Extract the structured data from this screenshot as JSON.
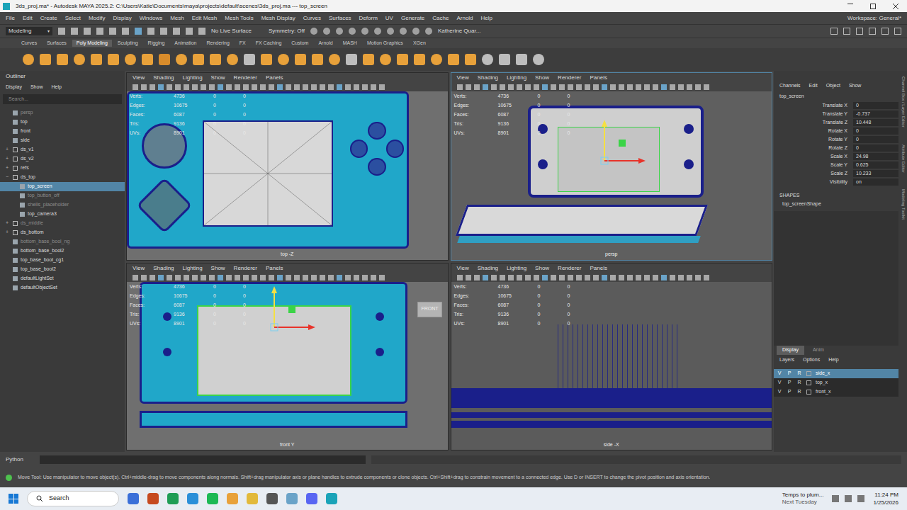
{
  "window": {
    "title": "3ds_proj.ma* - Autodesk MAYA 2025.2: C:\\Users\\Katie\\Documents\\maya\\projects\\default\\scenes\\3ds_proj.ma  ---  top_screen"
  },
  "menu_bar": [
    "File",
    "Edit",
    "Create",
    "Select",
    "Modify",
    "Display",
    "Windows",
    "Mesh",
    "Edit Mesh",
    "Mesh Tools",
    "Mesh Display",
    "Curves",
    "Surfaces",
    "Deform",
    "UV",
    "Generate",
    "Cache",
    "Arnold",
    "Help"
  ],
  "workspace": "Workspace: General*",
  "status_line": {
    "mode": "Modeling",
    "live_surface": "No Live Surface",
    "symmetry": "Symmetry: Off",
    "user": "Katherine Quar..."
  },
  "shelf": {
    "tabs": [
      {
        "label": "Curves",
        "selected": false
      },
      {
        "label": "Surfaces",
        "selected": false
      },
      {
        "label": "Poly Modeling",
        "selected": true
      },
      {
        "label": "Sculpting",
        "selected": false
      },
      {
        "label": "Rigging",
        "selected": false
      },
      {
        "label": "Animation",
        "selected": false
      },
      {
        "label": "Rendering",
        "selected": false
      },
      {
        "label": "FX",
        "selected": false
      },
      {
        "label": "FX Caching",
        "selected": false
      },
      {
        "label": "Custom",
        "selected": false
      },
      {
        "label": "Arnold",
        "selected": false
      },
      {
        "label": "MASH",
        "selected": false
      },
      {
        "label": "Motion Graphics",
        "selected": false
      },
      {
        "label": "XGen",
        "selected": false
      }
    ]
  },
  "outliner": {
    "title": "Outliner",
    "menu": [
      "Display",
      "Show",
      "Help"
    ],
    "search": "Search...",
    "items": [
      {
        "label": "persp",
        "depth": 0,
        "expandable": false,
        "expanded": false,
        "hidden": true,
        "selected": false
      },
      {
        "label": "top",
        "depth": 0,
        "expandable": false,
        "expanded": false,
        "hidden": false,
        "selected": false
      },
      {
        "label": "front",
        "depth": 0,
        "expandable": false,
        "expanded": false,
        "hidden": false,
        "selected": false
      },
      {
        "label": "side",
        "depth": 0,
        "expandable": false,
        "expanded": false,
        "hidden": false,
        "selected": false
      },
      {
        "label": "ds_v1",
        "depth": 0,
        "expandable": true,
        "expanded": false,
        "hidden": false,
        "selected": false
      },
      {
        "label": "ds_v2",
        "depth": 0,
        "expandable": true,
        "expanded": false,
        "hidden": false,
        "selected": false
      },
      {
        "label": "refs",
        "depth": 0,
        "expandable": true,
        "expanded": false,
        "hidden": false,
        "selected": false
      },
      {
        "label": "ds_top",
        "depth": 0,
        "expandable": true,
        "expanded": true,
        "hidden": false,
        "selected": false
      },
      {
        "label": "top_screen",
        "depth": 1,
        "expandable": false,
        "expanded": false,
        "hidden": false,
        "selected": true
      },
      {
        "label": "top_button_off",
        "depth": 1,
        "expandable": false,
        "expanded": false,
        "hidden": true,
        "selected": false
      },
      {
        "label": "shells_placeholder",
        "depth": 1,
        "expandable": false,
        "expanded": false,
        "hidden": true,
        "selected": false
      },
      {
        "label": "top_camera3",
        "depth": 1,
        "expandable": false,
        "expanded": false,
        "hidden": false,
        "selected": false
      },
      {
        "label": "ds_middle",
        "depth": 0,
        "expandable": true,
        "expanded": false,
        "hidden": true,
        "selected": false
      },
      {
        "label": "ds_bottom",
        "depth": 0,
        "expandable": true,
        "expanded": false,
        "hidden": false,
        "selected": false
      },
      {
        "label": "bottom_base_bool_ng",
        "depth": 0,
        "expandable": false,
        "expanded": false,
        "hidden": true,
        "selected": false
      },
      {
        "label": "bottom_base_bool2",
        "depth": 0,
        "expandable": false,
        "expanded": false,
        "hidden": false,
        "selected": false
      },
      {
        "label": "top_base_bool_cg1",
        "depth": 0,
        "expandable": false,
        "expanded": false,
        "hidden": false,
        "selected": false
      },
      {
        "label": "top_base_bool2",
        "depth": 0,
        "expandable": false,
        "expanded": false,
        "hidden": false,
        "selected": false
      },
      {
        "label": "defaultLightSet",
        "depth": 0,
        "expandable": false,
        "expanded": false,
        "hidden": false,
        "selected": false
      },
      {
        "label": "defaultObjectSet",
        "depth": 0,
        "expandable": false,
        "expanded": false,
        "hidden": false,
        "selected": false
      }
    ]
  },
  "viewport_menu": [
    "View",
    "Shading",
    "Lighting",
    "Show",
    "Renderer",
    "Panels"
  ],
  "hud": [
    {
      "label": "Verts:",
      "values": [
        "4736",
        "0",
        "0"
      ]
    },
    {
      "label": "Edges:",
      "values": [
        "10675",
        "0",
        "0"
      ]
    },
    {
      "label": "Faces:",
      "values": [
        "6087",
        "0",
        "0"
      ]
    },
    {
      "label": "Tris:",
      "values": [
        "9136",
        "0",
        "0"
      ]
    },
    {
      "label": "UVs:",
      "values": [
        "8901",
        "0",
        "0"
      ]
    }
  ],
  "viewports": [
    {
      "label": "top -Z",
      "kind": "top",
      "selected": false
    },
    {
      "label": "persp",
      "kind": "persp",
      "selected": true
    },
    {
      "label": "front Y",
      "kind": "front",
      "selected": false,
      "cube": "FRONT"
    },
    {
      "label": "side -X",
      "kind": "side",
      "selected": false
    }
  ],
  "channel_box": {
    "menu": [
      "Channels",
      "Edit",
      "Object",
      "Show"
    ],
    "object": "top_screen",
    "channels": [
      {
        "label": "Translate X",
        "value": "0"
      },
      {
        "label": "Translate Y",
        "value": "-0.737"
      },
      {
        "label": "Translate Z",
        "value": "10.448"
      },
      {
        "label": "Rotate X",
        "value": "0"
      },
      {
        "label": "Rotate Y",
        "value": "0"
      },
      {
        "label": "Rotate Z",
        "value": "0"
      },
      {
        "label": "Scale X",
        "value": "24.98"
      },
      {
        "label": "Scale Y",
        "value": "0.625"
      },
      {
        "label": "Scale Z",
        "value": "10.233"
      },
      {
        "label": "Visibility",
        "value": "on"
      }
    ],
    "shapes_title": "SHAPES",
    "shapes": [
      "top_screenShape"
    ]
  },
  "side_tabs": [
    "Channel Box / Layer Editor",
    "Attribute Editor",
    "Modeling Toolkit"
  ],
  "layer_editor": {
    "tabs": [
      {
        "label": "Display",
        "selected": true
      },
      {
        "label": "Anim",
        "selected": false
      }
    ],
    "menu": [
      "Layers",
      "Options",
      "Help"
    ],
    "layers": [
      {
        "name": "side_x",
        "selected": true,
        "flags": [
          "V",
          "P",
          "R"
        ]
      },
      {
        "name": "top_x",
        "selected": false,
        "flags": [
          "V",
          "P",
          "R"
        ]
      },
      {
        "name": "front_x",
        "selected": false,
        "flags": [
          "V",
          "P",
          "R"
        ]
      }
    ]
  },
  "command_line": {
    "language": "Python"
  },
  "help_line": "Move Tool: Use manipulator to move object(s). Ctrl+middle-drag to move components along normals. Shift+drag manipulator axis or plane handles to extrude components or clone objects. Ctrl+Shift+drag to constrain movement to a connected edge. Use D or INSERT to change the pivot position and axis orientation.",
  "taskbar": {
    "search": "Search",
    "notification": {
      "title": "Temps to plum...",
      "subtitle": "Next Tuesday"
    },
    "time": "11:24 PM",
    "date": "1/25/2026"
  }
}
